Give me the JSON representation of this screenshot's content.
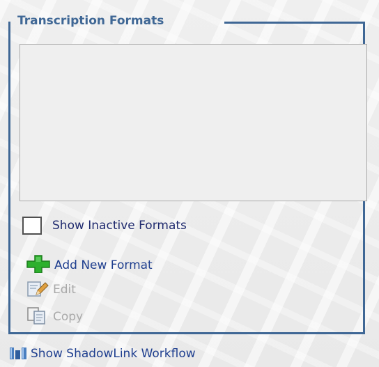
{
  "panel": {
    "legend": "Transcription Formats",
    "formats_list": []
  },
  "options": {
    "show_inactive_label": "Show Inactive Formats",
    "show_inactive_checked": false
  },
  "actions": {
    "add": {
      "label": "Add New Format",
      "icon": "plus-icon",
      "enabled": true
    },
    "edit": {
      "label": "Edit",
      "icon": "edit-pencil-icon",
      "enabled": false
    },
    "copy": {
      "label": "Copy",
      "icon": "copy-icon",
      "enabled": false
    }
  },
  "footer": {
    "workflow_label": "Show ShadowLink Workflow",
    "icon": "workflow-bars-icon"
  },
  "colors": {
    "accent": "#3f6795",
    "link": "#1f3f8f",
    "disabled": "#a9a9a9",
    "add_green": "#2db02d"
  }
}
